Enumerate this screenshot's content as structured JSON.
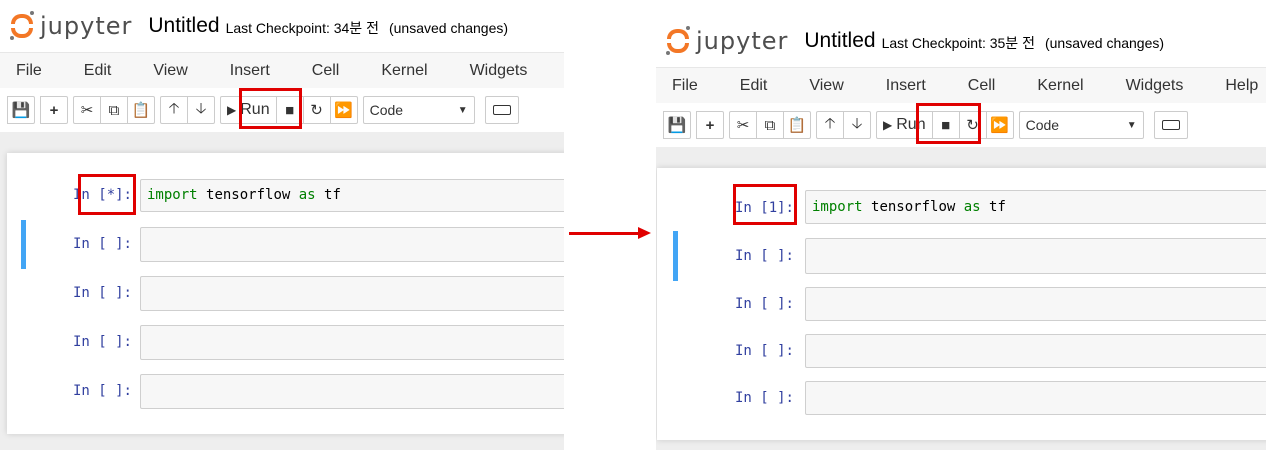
{
  "logo_text": "jupyter",
  "menu_items": [
    "File",
    "Edit",
    "View",
    "Insert",
    "Cell",
    "Kernel",
    "Widgets",
    "Help"
  ],
  "toolbar": {
    "run_label": "Run",
    "cell_type": "Code",
    "icons": [
      "save-icon",
      "plus-icon",
      "cut-icon",
      "copy-icon",
      "paste-icon",
      "arrow-up-icon",
      "arrow-down-icon",
      "play-icon",
      "stop-icon",
      "restart-icon",
      "fast-forward-icon",
      "keyboard-icon"
    ]
  },
  "code_keyword_import": "import",
  "code_module": "tensorflow",
  "code_keyword_as": "as",
  "code_alias": "tf",
  "before": {
    "notebook_title": "Untitled",
    "checkpoint": "Last Checkpoint: 34분 전",
    "unsaved": "(unsaved changes)",
    "cells": [
      {
        "prompt": "In [*]:"
      },
      {
        "prompt": "In [ ]:"
      },
      {
        "prompt": "In [ ]:"
      },
      {
        "prompt": "In [ ]:"
      },
      {
        "prompt": "In [ ]:"
      }
    ]
  },
  "after": {
    "notebook_title": "Untitled",
    "checkpoint": "Last Checkpoint: 35분 전",
    "unsaved": "(unsaved changes)",
    "cells": [
      {
        "prompt": "In [1]:"
      },
      {
        "prompt": "In [ ]:"
      },
      {
        "prompt": "In [ ]:"
      },
      {
        "prompt": "In [ ]:"
      },
      {
        "prompt": "In [ ]:"
      }
    ]
  },
  "colors": {
    "highlight": "#e00000",
    "logo_orange": "#f37726",
    "prompt_blue": "#303f9f",
    "keyword_green": "#008000",
    "selected_cell_bar": "#42a5f5"
  }
}
